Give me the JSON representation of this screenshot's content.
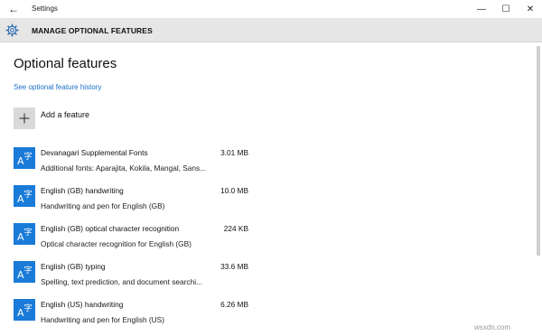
{
  "window": {
    "title": "Settings",
    "back_glyph": "←",
    "minimize_glyph": "—",
    "maximize_glyph": "☐",
    "close_glyph": "✕"
  },
  "header": {
    "title": "MANAGE OPTIONAL FEATURES",
    "icon": "gear-icon"
  },
  "main": {
    "page_title": "Optional features",
    "history_link": "See optional feature history",
    "add_feature_label": "Add a feature"
  },
  "features": [
    {
      "name": "Devanagari Supplemental Fonts",
      "size": "3.01 MB",
      "description": "Additional fonts: Aparajita, Kokila, Mangal, Sans..."
    },
    {
      "name": "English (GB) handwriting",
      "size": "10.0 MB",
      "description": "Handwriting and pen for English (GB)"
    },
    {
      "name": "English (GB) optical character recognition",
      "size": "224 KB",
      "description": "Optical character recognition for English (GB)"
    },
    {
      "name": "English (GB) typing",
      "size": "33.6 MB",
      "description": "Spelling, text prediction, and document searchi..."
    },
    {
      "name": "English (US) handwriting",
      "size": "6.26 MB",
      "description": "Handwriting and pen for English (US)"
    }
  ],
  "colors": {
    "accent": "#1a7bd8",
    "link": "#1a6fc9",
    "header_bg": "#e6e6e6"
  },
  "watermark": "wsxdn.com"
}
